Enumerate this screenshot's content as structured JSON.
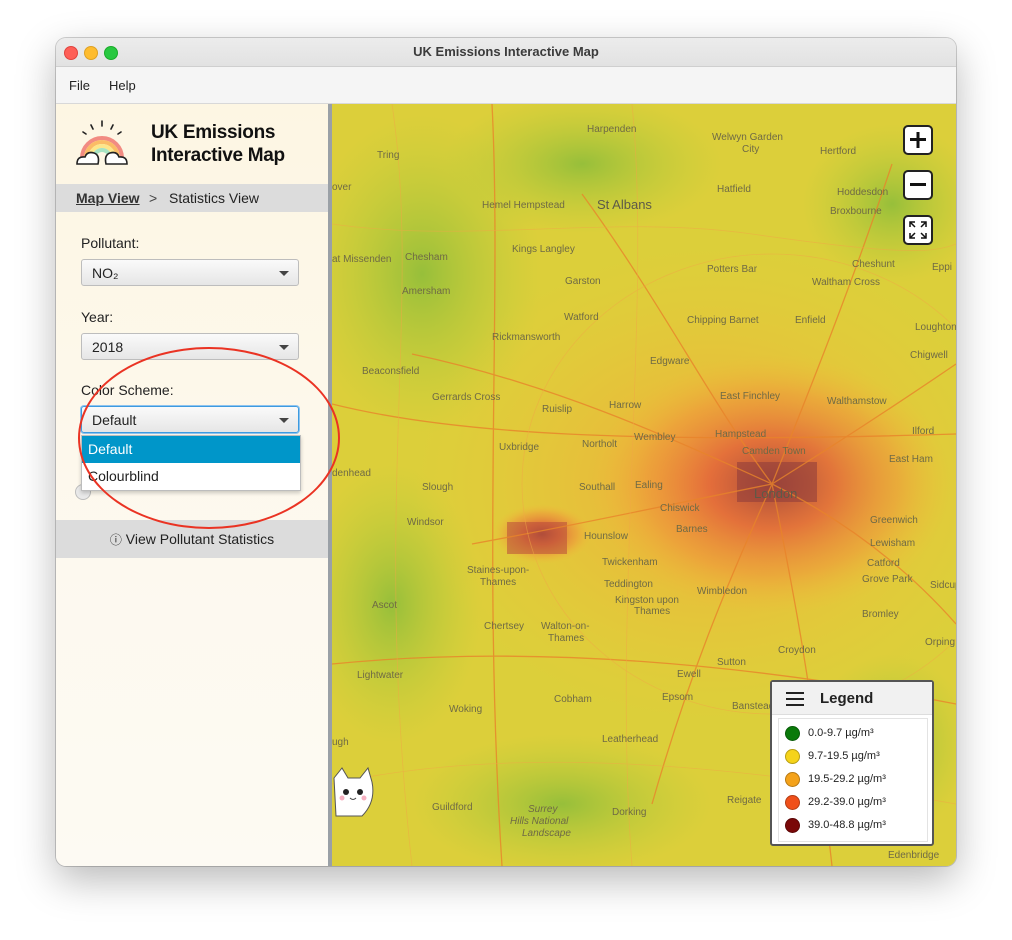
{
  "window": {
    "title": "UK Emissions Interactive Map"
  },
  "menu": {
    "items": [
      "File",
      "Help"
    ]
  },
  "sidebar": {
    "app_title_line1": "UK Emissions",
    "app_title_line2": "Interactive Map",
    "logo_icon": "rainbow-cloud-icon",
    "breadcrumb": {
      "current": "Map View",
      "separator": ">",
      "next": "Statistics View"
    },
    "pollutant": {
      "label": "Pollutant:",
      "value": "NO₂"
    },
    "year": {
      "label": "Year:",
      "value": "2018"
    },
    "color_scheme": {
      "label": "Color Scheme:",
      "value": "Default",
      "options": [
        "Default",
        "Colourblind"
      ],
      "selected": "Default"
    },
    "stats_button": {
      "icon": "info-icon",
      "label": "View Pollutant Statistics"
    }
  },
  "map": {
    "zoom_in_icon": "plus-icon",
    "zoom_out_icon": "minus-icon",
    "fullscreen_icon": "expand-icon",
    "places": {
      "harpenden": "Harpenden",
      "welwyn": "Welwyn Garden",
      "welwyn_city": "City",
      "tring": "Tring",
      "hertford": "Hertford",
      "hemel": "Hemel Hempstead",
      "st_albans": "St Albans",
      "hatfield": "Hatfield",
      "hoddesdon": "Hoddesdon",
      "broxbourne": "Broxbourne",
      "kings_langley": "Kings Langley",
      "chesham": "Chesham",
      "missenden": "at Missenden",
      "garston": "Garston",
      "potters_bar": "Potters Bar",
      "cheshunt": "Cheshunt",
      "waltham_cross": "Waltham Cross",
      "amersham": "Amersham",
      "watford": "Watford",
      "chipping_barnet": "Chipping Barnet",
      "enfield": "Enfield",
      "loughton": "Loughton",
      "rickmansworth": "Rickmansworth",
      "chigwell": "Chigwell",
      "edgware": "Edgware",
      "beaconsfield": "Beaconsfield",
      "east_finchley": "East Finchley",
      "walthamstow": "Walthamstow",
      "gerrards_cross": "Gerrards Cross",
      "ruislip": "Ruislip",
      "harrow": "Harrow",
      "hampstead": "Hampstead",
      "ilford": "Ilford",
      "uxbridge": "Uxbridge",
      "northolt": "Northolt",
      "wembley": "Wembley",
      "camden_town": "Camden Town",
      "east_ham": "East Ham",
      "slough": "Slough",
      "southall": "Southall",
      "ealing": "Ealing",
      "london": "London",
      "chiswick": "Chiswick",
      "windsor": "Windsor",
      "greenwich": "Greenwich",
      "hounslow": "Hounslow",
      "barnes": "Barnes",
      "lewisham": "Lewisham",
      "twickenham": "Twickenham",
      "catford": "Catford",
      "staines": "Staines-upon-",
      "thames": "Thames",
      "teddington": "Teddington",
      "grove_park": "Grove Park",
      "kingston": "Kingston upon",
      "kingston2": "Thames",
      "wimbledon": "Wimbledon",
      "sidcup": "Sidcup",
      "ascot": "Ascot",
      "chertsey": "Chertsey",
      "walton": "Walton-on-",
      "walton2": "Thames",
      "bromley": "Bromley",
      "orpington": "Orping",
      "sutton": "Sutton",
      "croydon": "Croydon",
      "lightwater": "Lightwater",
      "ewell": "Ewell",
      "cobham": "Cobham",
      "epsom": "Epsom",
      "banstead": "Banstead",
      "woking": "Woking",
      "leatherhead": "Leatherhead",
      "denham": "denhead",
      "guildford": "Guildford",
      "dorking": "Dorking",
      "reigate": "Reigate",
      "surrey": "Surrey",
      "hills": "Hills National",
      "landscape": "Landscape",
      "edenbridge": "Edenbridge",
      "epping": "Eppi",
      "over": "over",
      "ugh": "ugh"
    }
  },
  "legend": {
    "title": "Legend",
    "menu_icon": "hamburger-icon",
    "items": [
      {
        "label": "0.0-9.7 µg/m³",
        "color": "#0a7a0a"
      },
      {
        "label": "9.7-19.5 µg/m³",
        "color": "#f5d31a"
      },
      {
        "label": "19.5-29.2 µg/m³",
        "color": "#f4a21a"
      },
      {
        "label": "29.2-39.0 µg/m³",
        "color": "#f0501a"
      },
      {
        "label": "39.0-48.8 µg/m³",
        "color": "#7a0808"
      }
    ]
  }
}
